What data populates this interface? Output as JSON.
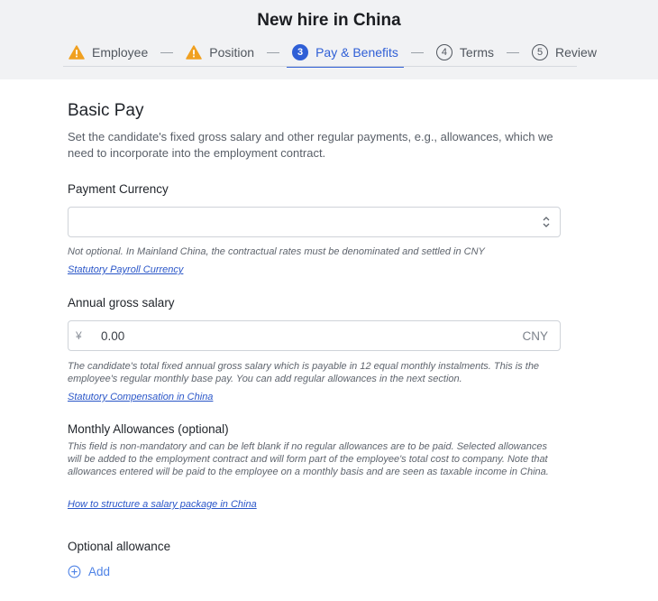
{
  "title": "New hire in China",
  "steps": [
    {
      "label": "Employee",
      "marker": "warning-icon"
    },
    {
      "label": "Position",
      "marker": "warning-icon"
    },
    {
      "label": "Pay & Benefits",
      "number": "3",
      "active": true
    },
    {
      "label": "Terms",
      "number": "4"
    },
    {
      "label": "Review",
      "number": "5"
    }
  ],
  "section": {
    "title": "Basic Pay",
    "description": "Set the candidate's fixed gross salary and other regular payments, e.g., allowances, which we need to incorporate into the employment contract."
  },
  "payment_currency": {
    "label": "Payment Currency",
    "value": "",
    "help": "Not optional. In Mainland China, the contractual rates must be denominated and settled in CNY",
    "link": "Statutory Payroll Currency"
  },
  "annual_salary": {
    "label": "Annual gross salary",
    "prefix": "¥",
    "value": "0.00",
    "suffix": "CNY",
    "help": "The candidate's total fixed annual gross salary which is payable in 12 equal monthly instalments. This is the employee's regular monthly base pay. You can add regular allowances in the next section.",
    "link": "Statutory Compensation in China"
  },
  "monthly_allowances": {
    "label": "Monthly Allowances (optional)",
    "help": "This field is non-mandatory and can be left blank if no regular allowances are to be paid. Selected allowances will be added to the employment contract and will form part of the employee's total cost to company. Note that allowances entered will be paid to the employee on a monthly basis and are seen as taxable income in China.",
    "link": "How to structure a salary package in China"
  },
  "optional_allowance": {
    "label": "Optional allowance",
    "add_label": "Add"
  },
  "colors": {
    "accent": "#2f5fd6",
    "warning": "#f0a020",
    "link": "#2a56c8"
  }
}
